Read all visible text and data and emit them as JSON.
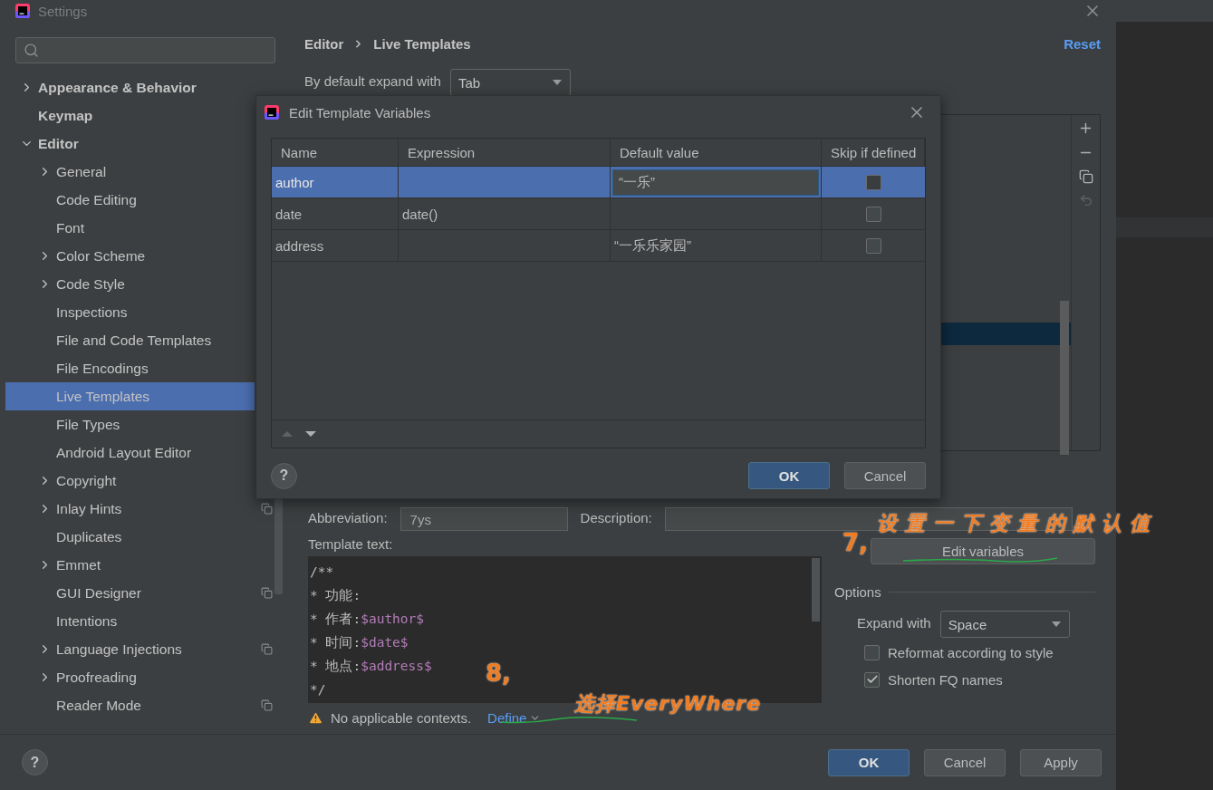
{
  "window": {
    "title": "Settings"
  },
  "sidebar": {
    "items": [
      {
        "label": "Appearance & Behavior",
        "expanded": false,
        "selected": false,
        "project_scope": false
      },
      {
        "label": "Keymap",
        "selected": false,
        "project_scope": false
      },
      {
        "label": "Editor",
        "expanded": true,
        "selected": false,
        "project_scope": false,
        "children": [
          {
            "label": "General",
            "expanded": false,
            "selected": false,
            "project_scope": false
          },
          {
            "label": "Code Editing",
            "selected": false,
            "project_scope": false
          },
          {
            "label": "Font",
            "selected": false,
            "project_scope": false
          },
          {
            "label": "Color Scheme",
            "expanded": false,
            "selected": false,
            "project_scope": false
          },
          {
            "label": "Code Style",
            "expanded": false,
            "selected": false,
            "project_scope": false
          },
          {
            "label": "Inspections",
            "selected": false,
            "project_scope": false
          },
          {
            "label": "File and Code Templates",
            "selected": false,
            "project_scope": false
          },
          {
            "label": "File Encodings",
            "selected": false,
            "project_scope": false
          },
          {
            "label": "Live Templates",
            "selected": true,
            "project_scope": false
          },
          {
            "label": "File Types",
            "selected": false,
            "project_scope": false
          },
          {
            "label": "Android Layout Editor",
            "selected": false,
            "project_scope": false
          },
          {
            "label": "Copyright",
            "expanded": false,
            "selected": false,
            "project_scope": false
          },
          {
            "label": "Inlay Hints",
            "expanded": false,
            "selected": false,
            "project_scope": true
          },
          {
            "label": "Duplicates",
            "selected": false,
            "project_scope": false
          },
          {
            "label": "Emmet",
            "expanded": false,
            "selected": false,
            "project_scope": false
          },
          {
            "label": "GUI Designer",
            "selected": false,
            "project_scope": true
          },
          {
            "label": "Intentions",
            "selected": false,
            "project_scope": false
          },
          {
            "label": "Language Injections",
            "expanded": false,
            "selected": false,
            "project_scope": true
          },
          {
            "label": "Proofreading",
            "expanded": false,
            "selected": false,
            "project_scope": false
          },
          {
            "label": "Reader Mode",
            "selected": false,
            "project_scope": true
          }
        ]
      }
    ]
  },
  "main": {
    "breadcrumb": [
      "Editor",
      "Live Templates"
    ],
    "reset": "Reset",
    "expand_default": {
      "label": "By default expand with",
      "value": "Tab"
    },
    "abbreviation": {
      "label": "Abbreviation:",
      "value": "7ys"
    },
    "description": {
      "label": "Description:"
    },
    "template_text": {
      "label": "Template text:",
      "lines": [
        [
          {
            "kind": "plain",
            "text": "/**"
          }
        ],
        [
          {
            "kind": "plain",
            "text": "* 功能:"
          }
        ],
        [
          {
            "kind": "plain",
            "text": "* 作者:"
          },
          {
            "kind": "variable",
            "text": "$author$"
          }
        ],
        [
          {
            "kind": "plain",
            "text": "* 时间:"
          },
          {
            "kind": "variable",
            "text": "$date$"
          }
        ],
        [
          {
            "kind": "plain",
            "text": "* 地点:"
          },
          {
            "kind": "variable",
            "text": "$address$"
          }
        ],
        [
          {
            "kind": "plain",
            "text": "*/"
          }
        ]
      ]
    },
    "edit_variables": "Edit variables",
    "options": {
      "title": "Options",
      "expand_with": {
        "label": "Expand with",
        "value": "Space"
      },
      "checkboxes": [
        {
          "label": "Reformat according to style",
          "checked": false
        },
        {
          "label": "Shorten FQ names",
          "checked": true
        }
      ]
    },
    "warning": {
      "text": "No applicable contexts.",
      "link": "Define"
    }
  },
  "help": "?",
  "buttons": [
    {
      "label": "OK",
      "primary": true
    },
    {
      "label": "Cancel",
      "primary": false
    },
    {
      "label": "Apply",
      "primary": false
    }
  ],
  "dialog": {
    "title": "Edit Template Variables",
    "columns": [
      "Name",
      "Expression",
      "Default value",
      "Skip if defined"
    ],
    "rows": [
      {
        "name": "author",
        "default_value": "“一乐”",
        "editing": true,
        "skip_if_defined": false,
        "selected": true
      },
      {
        "name": "date",
        "expression": "date()",
        "editing": false,
        "skip_if_defined": false,
        "selected": false
      },
      {
        "name": "address",
        "default_value": "“一乐乐家园”",
        "editing": false,
        "skip_if_defined": false,
        "selected": false
      }
    ],
    "help": "?",
    "buttons": [
      {
        "label": "OK",
        "primary": true
      },
      {
        "label": "Cancel",
        "primary": false
      }
    ]
  },
  "annotations": [
    {
      "number": "7,",
      "text": "设置一下变量的默认值"
    },
    {
      "number": "8,",
      "text": "选择EveryWhere"
    }
  ]
}
